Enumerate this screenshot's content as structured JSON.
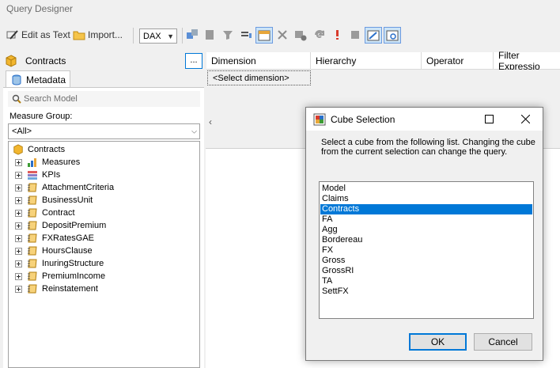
{
  "window": {
    "title": "Query Designer"
  },
  "toolbar": {
    "edit_as_text": "Edit as Text",
    "import": "Import...",
    "language": "DAX",
    "icons": [
      "cube-icon",
      "import-icon",
      "add-calc-icon",
      "delete-icon",
      "filter-icon",
      "parameter-icon",
      "show-empty-icon",
      "cancel-icon",
      "auto-execute-icon",
      "refresh-icon",
      "exclamation-icon",
      "stop-icon",
      "design-mode-icon",
      "query-mode-icon"
    ]
  },
  "left": {
    "cube_name": "Contracts",
    "cube_button": "...",
    "tab": "Metadata",
    "search_placeholder": "Search Model",
    "measure_group_label": "Measure Group:",
    "measure_group_value": "<All>",
    "tree": [
      {
        "label": "Contracts",
        "icon": "cube-icon",
        "level": 0
      },
      {
        "label": "Measures",
        "icon": "measures-icon",
        "level": 1
      },
      {
        "label": "KPIs",
        "icon": "kpi-icon",
        "level": 1
      },
      {
        "label": "AttachmentCriteria",
        "icon": "dimension-icon",
        "level": 1
      },
      {
        "label": "BusinessUnit",
        "icon": "dimension-icon",
        "level": 1
      },
      {
        "label": "Contract",
        "icon": "dimension-icon",
        "level": 1
      },
      {
        "label": "DepositPremium",
        "icon": "dimension-icon",
        "level": 1
      },
      {
        "label": "FXRatesGAE",
        "icon": "dimension-icon",
        "level": 1
      },
      {
        "label": "HoursClause",
        "icon": "dimension-icon",
        "level": 1
      },
      {
        "label": "InuringStructure",
        "icon": "dimension-icon",
        "level": 1
      },
      {
        "label": "PremiumIncome",
        "icon": "dimension-icon",
        "level": 1
      },
      {
        "label": "Reinstatement",
        "icon": "dimension-icon",
        "level": 1
      }
    ]
  },
  "filter_grid": {
    "columns": [
      "Dimension",
      "Hierarchy",
      "Operator",
      "Filter Expressio"
    ],
    "select_dimension": "<Select dimension>"
  },
  "dialog": {
    "title": "Cube Selection",
    "message": "Select a cube from the following list. Changing the cube from the current selection can change the query.",
    "items": [
      "Model",
      "Claims",
      "Contracts",
      "FA",
      "Agg",
      "Bordereau",
      "FX",
      "Gross",
      "GrossRI",
      "TA",
      "SettFX"
    ],
    "selected": "Contracts",
    "ok": "OK",
    "cancel": "Cancel"
  },
  "colors": {
    "selection": "#0078d7",
    "cube": "#f2b62f"
  }
}
